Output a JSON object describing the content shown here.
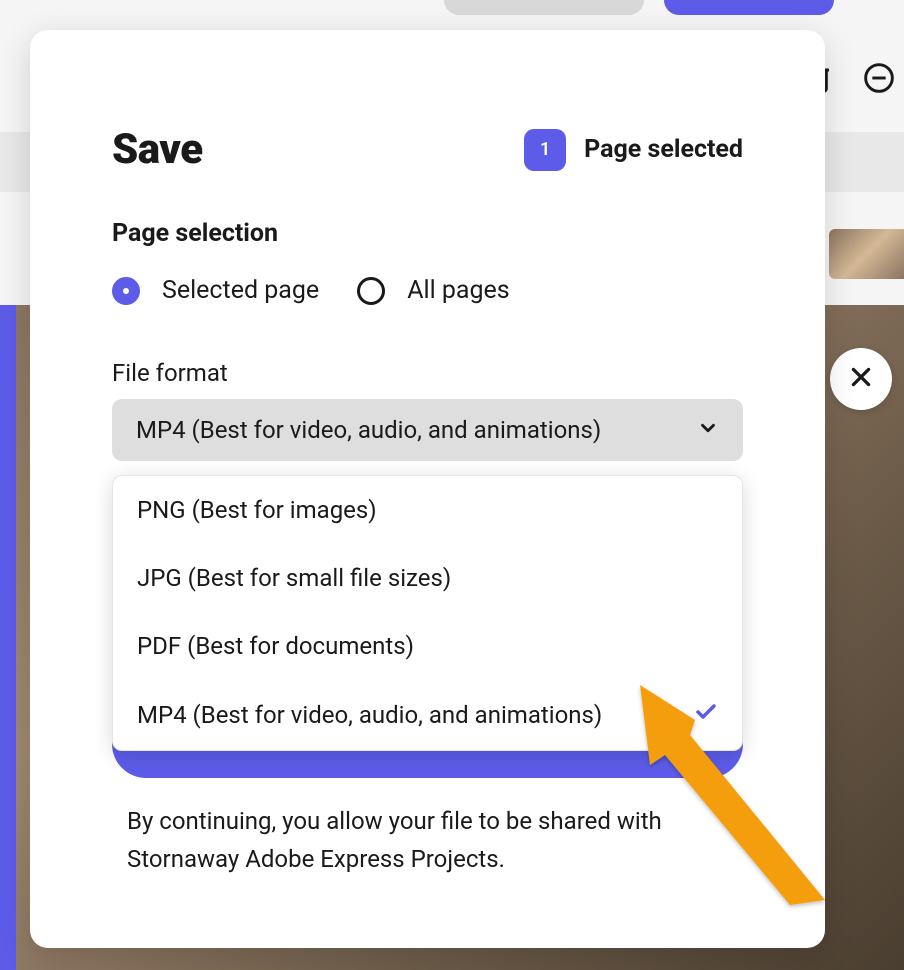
{
  "modal": {
    "title": "Save",
    "page_count": "1",
    "page_selected_label": "Page selected",
    "section_label": "Page selection",
    "radio_options": {
      "selected_page": "Selected page",
      "all_pages": "All pages"
    },
    "format_label": "File format",
    "selected_format": "MP4 (Best for video, audio, and animations)",
    "dropdown_options": [
      {
        "label": "PNG (Best for images)",
        "selected": false
      },
      {
        "label": "JPG (Best for small file sizes)",
        "selected": false
      },
      {
        "label": "PDF (Best for documents)",
        "selected": false
      },
      {
        "label": "MP4 (Best for video, audio, and animations)",
        "selected": true
      }
    ],
    "disclaimer": "By continuing, you allow your file to be shared with Stornaway Adobe Express Projects."
  }
}
